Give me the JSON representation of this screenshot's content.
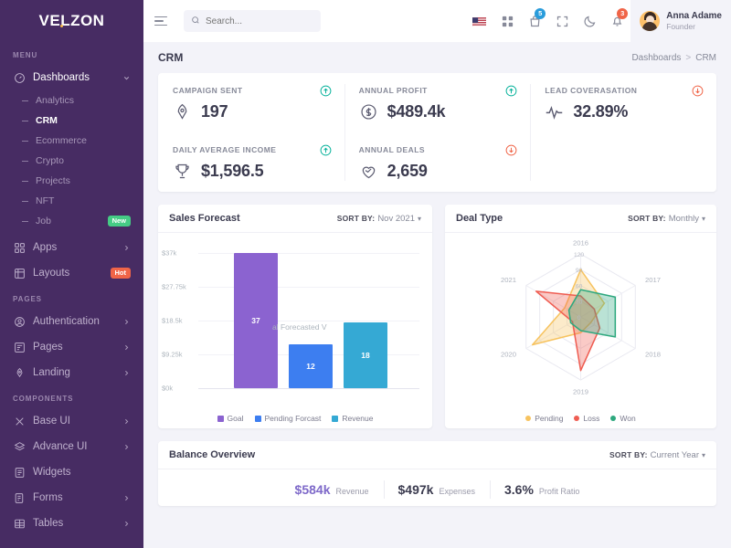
{
  "brand": {
    "name": "VELZON",
    "accent_dot": "#f7b84b",
    "sidebar_bg": "#472c63"
  },
  "sidebar": {
    "section_menu": "MENU",
    "section_pages": "PAGES",
    "section_components": "COMPONENTS",
    "dashboards": {
      "label": "Dashboards",
      "icon": "speedometer-icon"
    },
    "dashboard_children": [
      {
        "label": "Analytics",
        "active": false
      },
      {
        "label": "CRM",
        "active": true
      },
      {
        "label": "Ecommerce",
        "active": false
      },
      {
        "label": "Crypto",
        "active": false
      },
      {
        "label": "Projects",
        "active": false
      },
      {
        "label": "NFT",
        "active": false
      },
      {
        "label": "Job",
        "active": false,
        "badge": "New"
      }
    ],
    "menu_items": [
      {
        "label": "Apps",
        "icon": "grid-icon",
        "badge": ""
      },
      {
        "label": "Layouts",
        "icon": "layout-icon",
        "badge": "Hot"
      }
    ],
    "pages_items": [
      {
        "label": "Authentication",
        "icon": "user-circle-icon"
      },
      {
        "label": "Pages",
        "icon": "page-icon"
      },
      {
        "label": "Landing",
        "icon": "rocket-icon"
      }
    ],
    "components_items": [
      {
        "label": "Base UI",
        "icon": "braces-icon",
        "arrow": true
      },
      {
        "label": "Advance UI",
        "icon": "layers-icon",
        "arrow": true
      },
      {
        "label": "Widgets",
        "icon": "widget-icon",
        "arrow": false
      },
      {
        "label": "Forms",
        "icon": "form-icon",
        "arrow": true
      },
      {
        "label": "Tables",
        "icon": "table-icon",
        "arrow": true
      }
    ]
  },
  "topbar": {
    "search_placeholder": "Search...",
    "cart_badge": "5",
    "bell_badge": "3",
    "user": {
      "name": "Anna Adame",
      "role": "Founder"
    }
  },
  "pagehead": {
    "title": "CRM",
    "breadcrumb_parent": "Dashboards",
    "breadcrumb_sep": ">",
    "breadcrumb_current": "CRM"
  },
  "stats": [
    {
      "label": "CAMPAIGN SENT",
      "value": "197",
      "icon": "rocket-badge-icon",
      "trend": "up",
      "trend_color": "#0ab39c"
    },
    {
      "label": "ANNUAL PROFIT",
      "value": "$489.4k",
      "icon": "dollar-circle-icon",
      "trend": "up",
      "trend_color": "#0ab39c"
    },
    {
      "label": "LEAD COVERASATION",
      "value": "32.89%",
      "icon": "pulse-icon",
      "trend": "down",
      "trend_color": "#f06548"
    },
    {
      "label": "DAILY AVERAGE INCOME",
      "value": "$1,596.5",
      "icon": "trophy-icon",
      "trend": "up",
      "trend_color": "#0ab39c"
    },
    {
      "label": "ANNUAL DEALS",
      "value": "2,659",
      "icon": "handshake-heart-icon",
      "trend": "down",
      "trend_color": "#f06548"
    }
  ],
  "sales_forecast": {
    "title": "Sales Forecast",
    "sort_label": "SORT BY:",
    "sort_value": "Nov 2021",
    "overlay_note": "al Forecasted V"
  },
  "deal_type": {
    "title": "Deal Type",
    "sort_label": "SORT BY:",
    "sort_value": "Monthly"
  },
  "balance": {
    "title": "Balance Overview",
    "sort_label": "SORT BY:",
    "sort_value": "Current Year",
    "items": [
      {
        "value": "$584k",
        "caption": "Revenue",
        "accent": true
      },
      {
        "value": "$497k",
        "caption": "Expenses",
        "accent": false
      },
      {
        "value": "3.6%",
        "caption": "Profit Ratio",
        "accent": false
      }
    ]
  },
  "chart_data": [
    {
      "type": "bar",
      "title": "Sales Forecast",
      "categories": [
        "Goal",
        "Pending Forcast",
        "Revenue"
      ],
      "values": [
        37,
        12,
        18
      ],
      "bar_labels": [
        "37",
        "12",
        "18"
      ],
      "colors": [
        "#8b63d0",
        "#3d7ef0",
        "#35a9d4"
      ],
      "ylabel": "",
      "xlabel": "",
      "ytick_labels": [
        "$0k",
        "$9.25k",
        "$18.5k",
        "$27.75k",
        "$37k"
      ],
      "ytick_values": [
        0,
        9.25,
        18.5,
        27.75,
        37
      ],
      "ylim": [
        0,
        37
      ],
      "grid": true,
      "legend": [
        "Goal",
        "Pending Forcast",
        "Revenue"
      ],
      "legend_position": "bottom"
    },
    {
      "type": "radar",
      "title": "Deal Type",
      "categories": [
        "2016",
        "2017",
        "2018",
        "2019",
        "2020",
        "2021"
      ],
      "rtick_labels": [
        "0",
        "30",
        "60",
        "90",
        "120"
      ],
      "rtick_values": [
        0,
        30,
        60,
        90,
        120
      ],
      "rlim": [
        0,
        120
      ],
      "series": [
        {
          "name": "Pending",
          "color": "#f7c35f",
          "values": [
            90,
            52,
            22,
            30,
            106,
            35
          ]
        },
        {
          "name": "Loss",
          "color": "#ef5d52",
          "values": [
            40,
            30,
            42,
            102,
            18,
            98
          ]
        },
        {
          "name": "Won",
          "color": "#2ea87e",
          "values": [
            52,
            76,
            76,
            26,
            22,
            26
          ]
        }
      ],
      "legend": [
        "Pending",
        "Loss",
        "Won"
      ],
      "legend_position": "bottom",
      "grid": true
    }
  ]
}
